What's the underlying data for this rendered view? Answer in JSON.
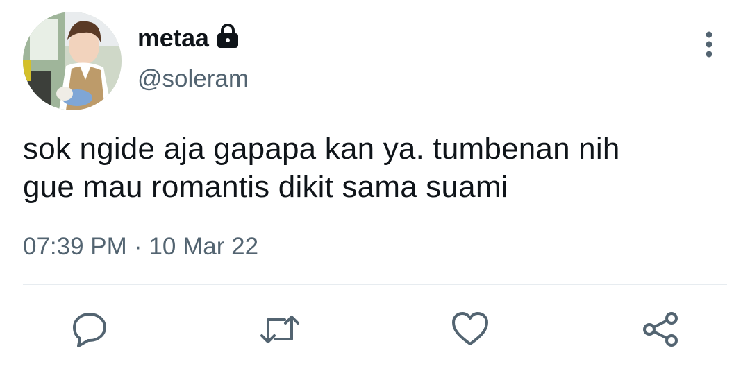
{
  "user": {
    "display_name": "metaa",
    "handle": "@soleram",
    "protected": true
  },
  "tweet": {
    "text_lines": [
      "sok ngide aja gapapa kan ya. tumbenan nih",
      "gue mau romantis dikit sama suami"
    ],
    "time": "07:39 PM",
    "separator": "·",
    "date": "10 Mar 22"
  },
  "icons": {
    "lock": "lock-icon",
    "more": "more-vertical-icon",
    "reply": "reply-icon",
    "retweet": "retweet-icon",
    "like": "heart-icon",
    "share": "share-icon"
  },
  "colors": {
    "text_primary": "#0f1419",
    "text_secondary": "#536471",
    "icon": "#536471",
    "divider": "#e7ecf0"
  }
}
